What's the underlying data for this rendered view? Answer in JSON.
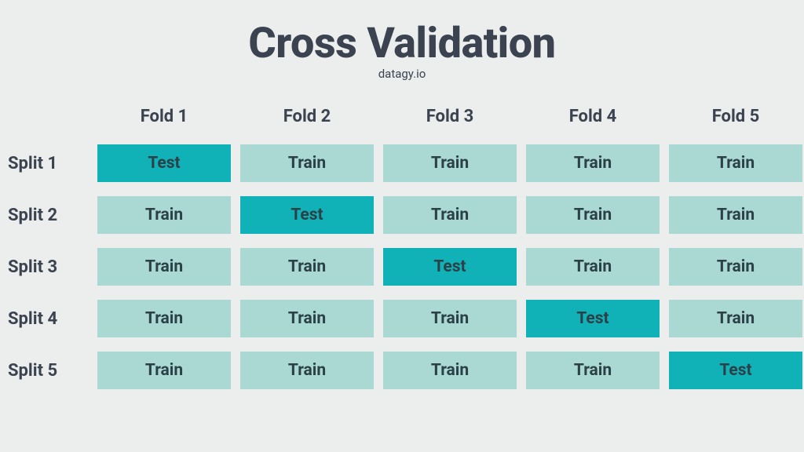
{
  "title": "Cross Validation",
  "subtitle": "datagy.io",
  "column_headers": [
    "Fold 1",
    "Fold 2",
    "Fold 3",
    "Fold 4",
    "Fold 5"
  ],
  "row_labels": [
    "Split 1",
    "Split 2",
    "Split 3",
    "Split 4",
    "Split 5"
  ],
  "labels": {
    "test": "Test",
    "train": "Train"
  },
  "grid": [
    [
      "test",
      "train",
      "train",
      "train",
      "train"
    ],
    [
      "train",
      "test",
      "train",
      "train",
      "train"
    ],
    [
      "train",
      "train",
      "test",
      "train",
      "train"
    ],
    [
      "train",
      "train",
      "train",
      "test",
      "train"
    ],
    [
      "train",
      "train",
      "train",
      "train",
      "test"
    ]
  ],
  "colors": {
    "background": "#eceded",
    "text_dark": "#3a434f",
    "cell_text": "#2c4047",
    "train": "#a9d9d2",
    "test": "#11b2b7"
  }
}
